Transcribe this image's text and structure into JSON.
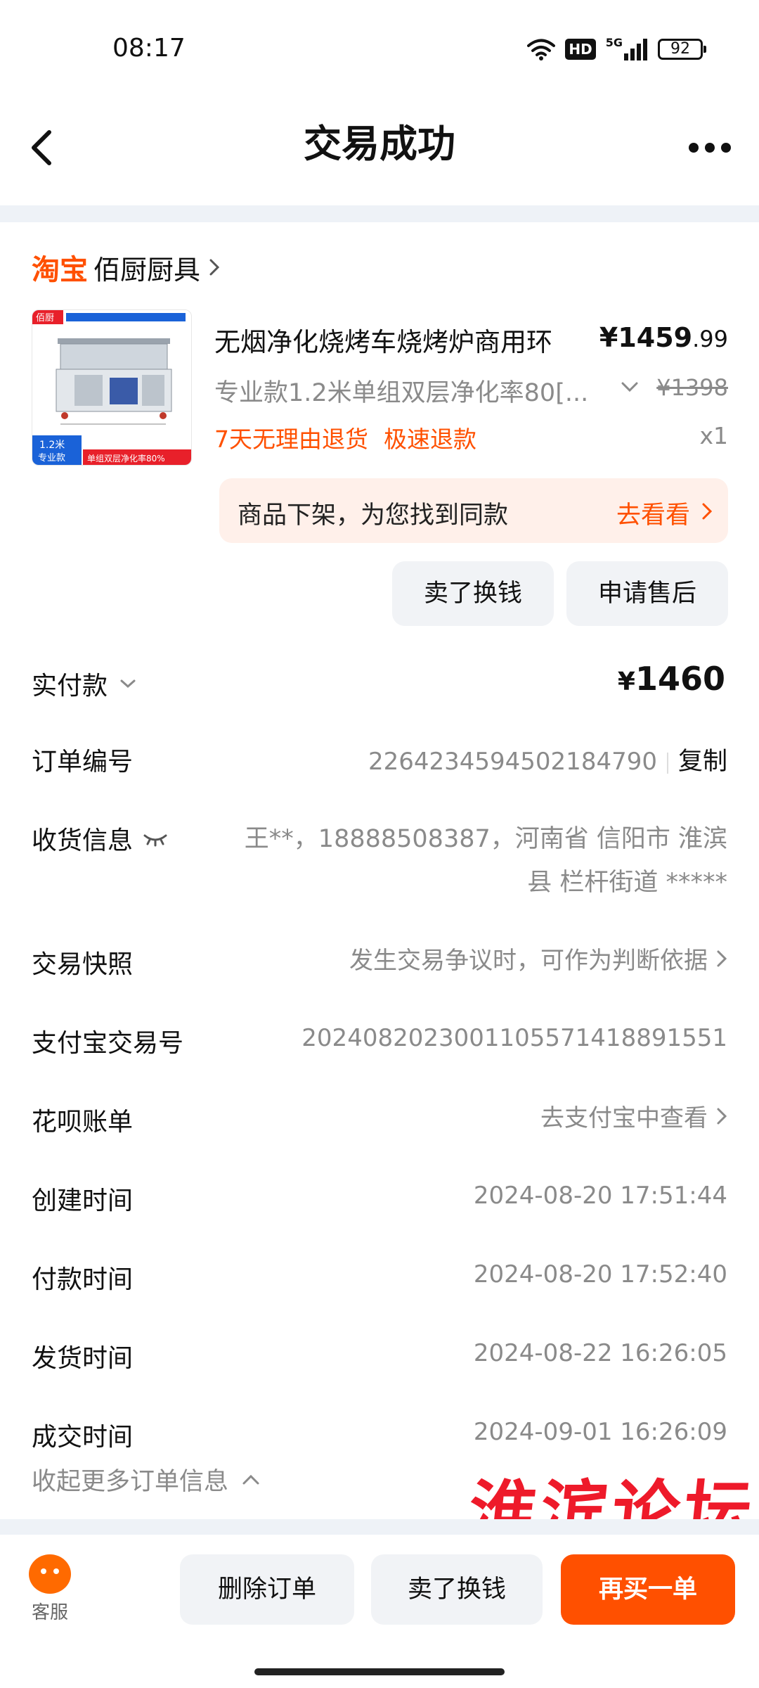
{
  "status_bar": {
    "time": "08:17",
    "hd_label": "HD",
    "network_label": "5G",
    "battery": "92",
    "icons": [
      "wifi-icon",
      "signal-icon",
      "battery-icon"
    ]
  },
  "header": {
    "title": "交易成功",
    "back_icon": "chevron-left-icon",
    "more_icon": "more-dots-icon"
  },
  "shop": {
    "platform": "淘宝",
    "name": "佰厨厨具"
  },
  "product": {
    "image_text": {
      "brand": "佰厨",
      "size_tag": "1.2米",
      "edition_tag": "专业款",
      "feature_tag": "单组双层净化率80%"
    },
    "title": "无烟净化烧烤车烧烤炉商用环",
    "price_main": "¥1459",
    "price_decimal": ".99",
    "spec": "专业款1.2米单组双层净化率80[...",
    "original_price": "¥1398",
    "tags": [
      "7天无理由退货",
      "极速退款"
    ],
    "quantity": "x1"
  },
  "promo": {
    "text": "商品下架，为您找到同款",
    "link": "去看看"
  },
  "actions": {
    "sell_label": "卖了换钱",
    "after_sale_label": "申请售后"
  },
  "order_info": {
    "paid_label": "实付款",
    "paid_currency": "¥",
    "paid_amount": "1460",
    "order_no_label": "订单编号",
    "order_no": "2264234594502184790",
    "copy_label": "复制",
    "shipping_label": "收货信息",
    "shipping_value": "王**，18888508387，河南省 信阳市 淮滨县 栏杆街道 *****",
    "snapshot_label": "交易快照",
    "snapshot_value": "发生交易争议时，可作为判断依据",
    "alipay_label": "支付宝交易号",
    "alipay_value": "2024082023001105571418891551",
    "huabei_label": "花呗账单",
    "huabei_value": "去支付宝中查看",
    "created_label": "创建时间",
    "created_value": "2024-08-20 17:51:44",
    "paid_time_label": "付款时间",
    "paid_time_value": "2024-08-20 17:52:40",
    "shipped_label": "发货时间",
    "shipped_value": "2024-08-22 16:26:05",
    "completed_label": "成交时间",
    "completed_value": "2024-09-01 16:26:09",
    "collapse_label": "收起更多订单信息"
  },
  "watermark": "淮滨论坛",
  "bottom_bar": {
    "service_label": "客服",
    "delete_label": "删除订单",
    "sell_label": "卖了换钱",
    "rebuy_label": "再买一单"
  },
  "colors": {
    "accent": "#ff5000",
    "promo_bg": "#fff0ea",
    "muted_text": "#8a8a8a",
    "button_bg": "#f1f3f6"
  }
}
